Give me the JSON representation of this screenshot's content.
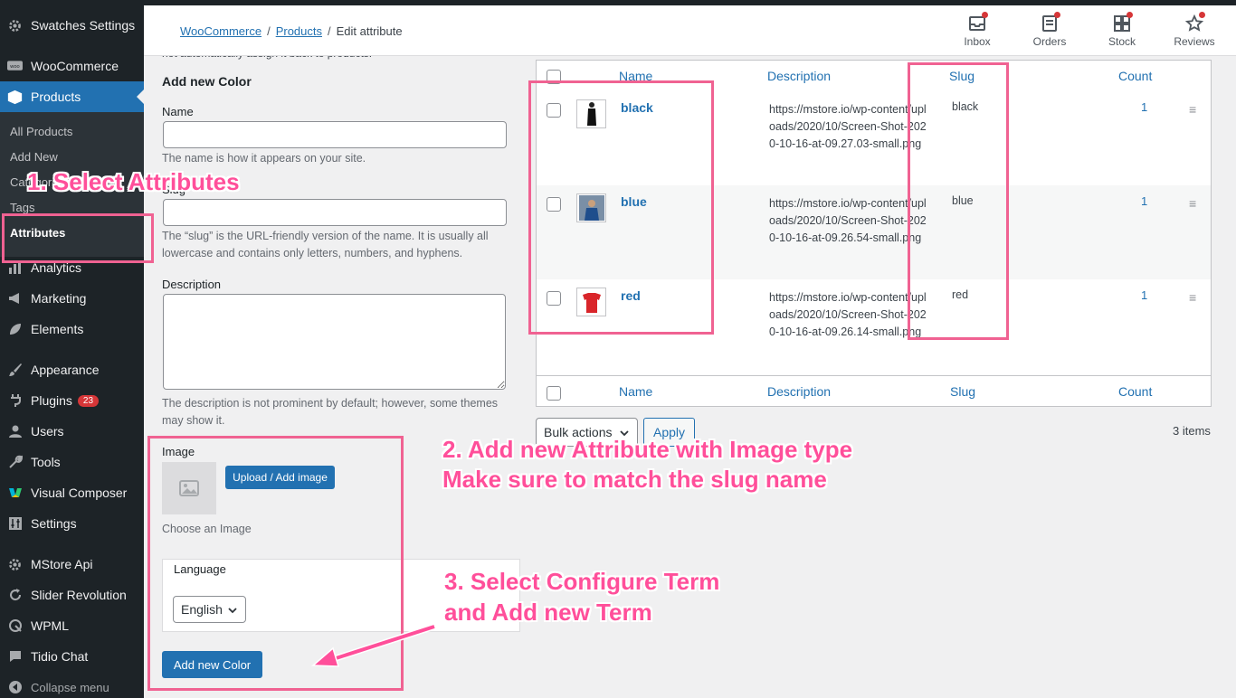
{
  "sidebar": {
    "items": [
      {
        "label": "Swatches Settings",
        "icon": "gear-icon"
      },
      {
        "label": "WooCommerce",
        "icon": "woo-icon"
      },
      {
        "label": "Products",
        "icon": "box-icon"
      },
      {
        "label": "Analytics",
        "icon": "bar-chart-icon"
      },
      {
        "label": "Marketing",
        "icon": "megaphone-icon"
      },
      {
        "label": "Elements",
        "icon": "leaf-icon"
      },
      {
        "label": "Appearance",
        "icon": "paintbrush-icon"
      },
      {
        "label": "Plugins",
        "icon": "plug-icon",
        "badge": "23"
      },
      {
        "label": "Users",
        "icon": "user-icon"
      },
      {
        "label": "Tools",
        "icon": "wrench-icon"
      },
      {
        "label": "Visual Composer",
        "icon": "vc-logo-icon"
      },
      {
        "label": "Settings",
        "icon": "sliders-icon"
      },
      {
        "label": "MStore Api",
        "icon": "gear-icon"
      },
      {
        "label": "Slider Revolution",
        "icon": "refresh-icon"
      },
      {
        "label": "WPML",
        "icon": "wpml-icon"
      },
      {
        "label": "Tidio Chat",
        "icon": "chat-icon"
      },
      {
        "label": "Collapse menu",
        "icon": "collapse-icon"
      }
    ],
    "submenu": [
      "All Products",
      "Add New",
      "Categories",
      "Tags",
      "Attributes"
    ]
  },
  "header": {
    "breadcrumb": [
      "WooCommerce",
      "Products",
      "Edit attribute"
    ],
    "actions": [
      {
        "label": "Inbox",
        "icon": "inbox-icon"
      },
      {
        "label": "Orders",
        "icon": "orders-icon"
      },
      {
        "label": "Stock",
        "icon": "stock-icon"
      },
      {
        "label": "Reviews",
        "icon": "star-icon"
      }
    ]
  },
  "form": {
    "cut_text": "not automatically assign it back to products.",
    "title": "Add new Color",
    "name_label": "Name",
    "name_help": "The name is how it appears on your site.",
    "slug_label": "Slug",
    "slug_help": "The “slug” is the URL-friendly version of the name. It is usually all lowercase and contains only letters, numbers, and hyphens.",
    "description_label": "Description",
    "description_help": "The description is not prominent by default; however, some themes may show it.",
    "image_label": "Image",
    "upload_button": "Upload / Add image",
    "choose_image": "Choose an Image",
    "language_label": "Language",
    "language_value": "English",
    "submit_button": "Add new Color"
  },
  "table": {
    "columns": [
      "Name",
      "Description",
      "Slug",
      "Count"
    ],
    "rows": [
      {
        "name": "black",
        "description": "https://mstore.io/wp-content/uploads/2020/10/Screen-Shot-2020-10-16-at-09.27.03-small.png",
        "slug": "black",
        "count": "1"
      },
      {
        "name": "blue",
        "description": "https://mstore.io/wp-content/uploads/2020/10/Screen-Shot-2020-10-16-at-09.26.54-small.png",
        "slug": "blue",
        "count": "1"
      },
      {
        "name": "red",
        "description": "https://mstore.io/wp-content/uploads/2020/10/Screen-Shot-2020-10-16-at-09.26.14-small.png",
        "slug": "red",
        "count": "1"
      }
    ],
    "bulk_actions": "Bulk actions",
    "apply": "Apply",
    "item_count": "3 items"
  },
  "annotations": {
    "step1": "1. Select Attributes",
    "step2_line1": "2. Add new Attribute with Image type",
    "step2_line2": "Make sure to match the slug name",
    "step3_line1": "3. Select Configure Term",
    "step3_line2": "and Add new Term"
  },
  "colors": {
    "accent": "#2271b1",
    "sidebar_bg": "#1d2327",
    "annotation_pink": "#ff4f9a"
  }
}
